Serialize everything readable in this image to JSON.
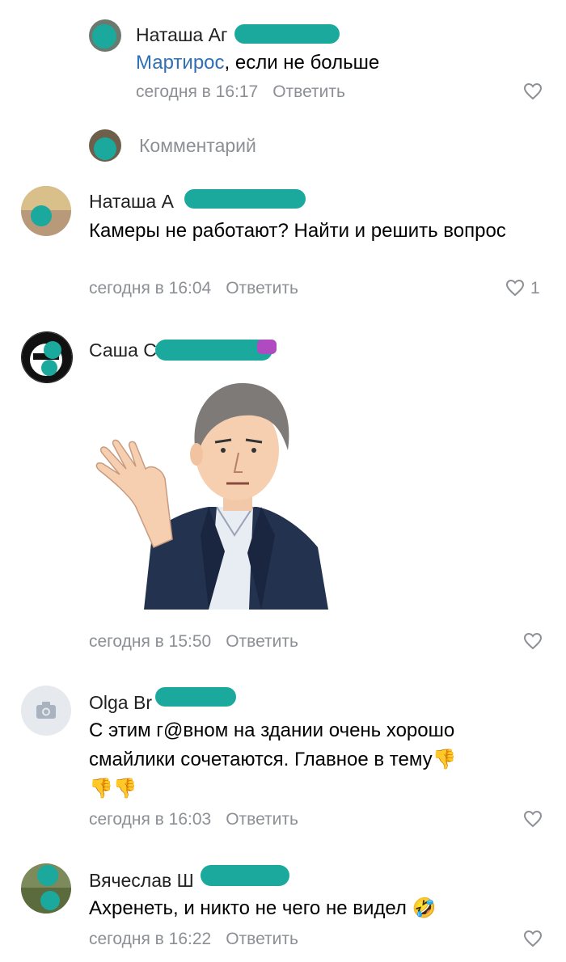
{
  "reply_block": {
    "author": "Наташа Аг",
    "mention": "Мартирос",
    "text": ", если не больше",
    "time": "сегодня в 16:17",
    "reply_label": "Ответить"
  },
  "composer": {
    "placeholder": "Комментарий"
  },
  "comments": [
    {
      "author": "Наташа А",
      "text": "Камеры не работают? Найти и решить вопрос",
      "time": "сегодня в 16:04",
      "reply_label": "Ответить",
      "likes": "1"
    },
    {
      "author": "Саша С",
      "time": "сегодня в 15:50",
      "reply_label": "Ответить"
    },
    {
      "author": "Olga Br",
      "text": "С этим г@вном на здании очень хорошо смайлики сочетаются. Главное  в тему",
      "emoji": "👎",
      "emoji_line2": "👎👎",
      "time": "сегодня в 16:03",
      "reply_label": "Ответить"
    },
    {
      "author": "Вячеслав Ш",
      "text": "Ахренеть, и никто не чего не видел",
      "emoji": "🤣",
      "time": "сегодня в 16:22",
      "reply_label": "Ответить"
    }
  ],
  "colors": {
    "redaction": "#1aa99c",
    "link": "#2f6fb5",
    "meta": "#8c8f94"
  }
}
